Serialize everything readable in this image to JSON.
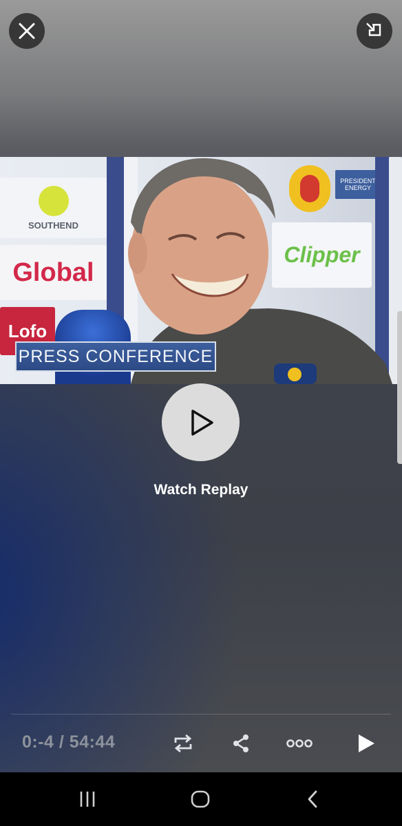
{
  "video": {
    "banner_text": "PRESS CONFERENCE",
    "sponsors": {
      "southend": "SOUTHEND",
      "global": "Global",
      "clipper": "Clipper",
      "president_energy_line1": "PRESIDENT",
      "president_energy_line2": "ENERGY",
      "partial_left": "Lofo"
    }
  },
  "player": {
    "watch_label": "Watch Replay",
    "time_display": "0:-4 / 54:44"
  },
  "icons": {
    "close": "close-icon",
    "pip": "picture-in-picture-icon",
    "play": "play-icon",
    "repeat": "repeat-icon",
    "share": "share-icon",
    "more": "more-icon",
    "play_small": "play-icon",
    "nav_recents": "recents-icon",
    "nav_home": "home-icon",
    "nav_back": "back-icon"
  },
  "colors": {
    "banner_blue": "#2c4a86",
    "time_text": "#8d929c",
    "play_circle": "#dcdcdc"
  }
}
